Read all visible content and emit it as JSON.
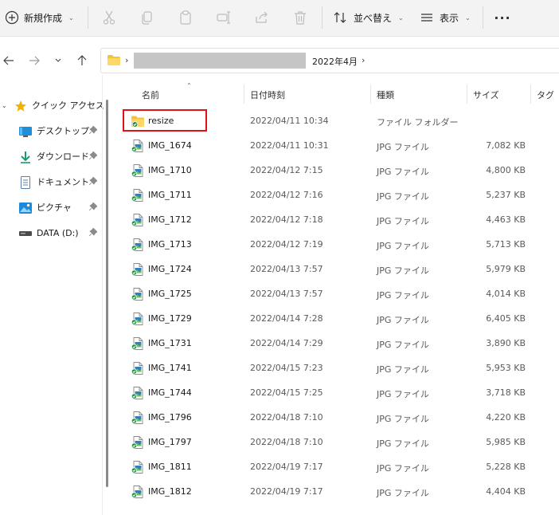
{
  "toolbar": {
    "new_label": "新規作成",
    "sort_label": "並べ替え",
    "view_label": "表示",
    "more_label": "···"
  },
  "address": {
    "current_folder": "2022年4月"
  },
  "sidebar": {
    "items": [
      {
        "label": "クイック アクセス",
        "icon": "star-icon"
      },
      {
        "label": "デスクトップ",
        "icon": "desktop-icon"
      },
      {
        "label": "ダウンロード",
        "icon": "download-icon"
      },
      {
        "label": "ドキュメント",
        "icon": "document-icon"
      },
      {
        "label": "ピクチャ",
        "icon": "pictures-icon"
      },
      {
        "label": "DATA (D:)",
        "icon": "drive-icon"
      }
    ]
  },
  "columns": {
    "name": "名前",
    "date": "日付時刻",
    "type": "種類",
    "size": "サイズ",
    "tag": "タグ"
  },
  "files": [
    {
      "name": "resize",
      "date": "2022/04/11 10:34",
      "type": "ファイル フォルダー",
      "size": ""
    },
    {
      "name": "IMG_1674",
      "date": "2022/04/11 10:31",
      "type": "JPG ファイル",
      "size": "7,082 KB"
    },
    {
      "name": "IMG_1710",
      "date": "2022/04/12 7:15",
      "type": "JPG ファイル",
      "size": "4,800 KB"
    },
    {
      "name": "IMG_1711",
      "date": "2022/04/12 7:16",
      "type": "JPG ファイル",
      "size": "5,237 KB"
    },
    {
      "name": "IMG_1712",
      "date": "2022/04/12 7:18",
      "type": "JPG ファイル",
      "size": "4,463 KB"
    },
    {
      "name": "IMG_1713",
      "date": "2022/04/12 7:19",
      "type": "JPG ファイル",
      "size": "5,713 KB"
    },
    {
      "name": "IMG_1724",
      "date": "2022/04/13 7:57",
      "type": "JPG ファイル",
      "size": "5,979 KB"
    },
    {
      "name": "IMG_1725",
      "date": "2022/04/13 7:57",
      "type": "JPG ファイル",
      "size": "4,014 KB"
    },
    {
      "name": "IMG_1729",
      "date": "2022/04/14 7:28",
      "type": "JPG ファイル",
      "size": "6,405 KB"
    },
    {
      "name": "IMG_1731",
      "date": "2022/04/14 7:29",
      "type": "JPG ファイル",
      "size": "3,890 KB"
    },
    {
      "name": "IMG_1741",
      "date": "2022/04/15 7:23",
      "type": "JPG ファイル",
      "size": "5,953 KB"
    },
    {
      "name": "IMG_1744",
      "date": "2022/04/15 7:25",
      "type": "JPG ファイル",
      "size": "3,718 KB"
    },
    {
      "name": "IMG_1796",
      "date": "2022/04/18 7:10",
      "type": "JPG ファイル",
      "size": "4,220 KB"
    },
    {
      "name": "IMG_1797",
      "date": "2022/04/18 7:10",
      "type": "JPG ファイル",
      "size": "5,985 KB"
    },
    {
      "name": "IMG_1811",
      "date": "2022/04/19 7:17",
      "type": "JPG ファイル",
      "size": "5,228 KB"
    },
    {
      "name": "IMG_1812",
      "date": "2022/04/19 7:17",
      "type": "JPG ファイル",
      "size": "4,404 KB"
    }
  ],
  "colors": {
    "highlight": "#d9141b",
    "folder": "#f5c33b",
    "accent": "#0067c0"
  }
}
